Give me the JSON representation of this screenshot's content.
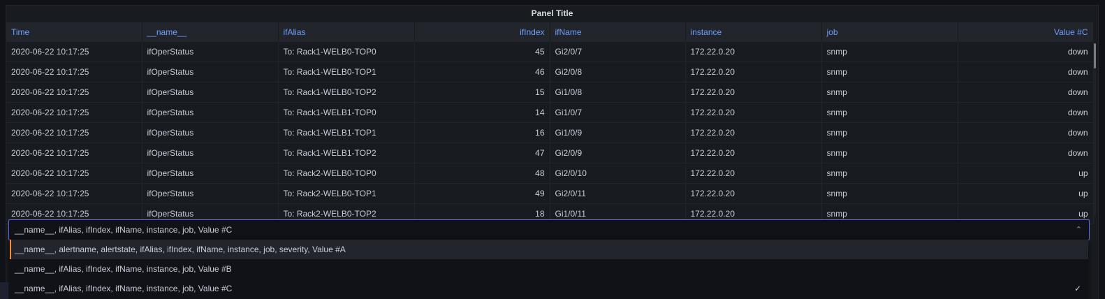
{
  "panel": {
    "title": "Panel Title"
  },
  "table": {
    "columns": [
      "Time",
      "__name__",
      "ifAlias",
      "ifIndex",
      "ifName",
      "instance",
      "job",
      "Value #C"
    ],
    "rows": [
      [
        "2020-06-22 10:17:25",
        "ifOperStatus",
        "To: Rack1-WELB0-TOP0",
        "45",
        "Gi2/0/7",
        "172.22.0.20",
        "snmp",
        "down"
      ],
      [
        "2020-06-22 10:17:25",
        "ifOperStatus",
        "To: Rack1-WELB0-TOP1",
        "46",
        "Gi2/0/8",
        "172.22.0.20",
        "snmp",
        "down"
      ],
      [
        "2020-06-22 10:17:25",
        "ifOperStatus",
        "To: Rack1-WELB0-TOP2",
        "15",
        "Gi1/0/8",
        "172.22.0.20",
        "snmp",
        "down"
      ],
      [
        "2020-06-22 10:17:25",
        "ifOperStatus",
        "To: Rack1-WELB1-TOP0",
        "14",
        "Gi1/0/7",
        "172.22.0.20",
        "snmp",
        "down"
      ],
      [
        "2020-06-22 10:17:25",
        "ifOperStatus",
        "To: Rack1-WELB1-TOP1",
        "16",
        "Gi1/0/9",
        "172.22.0.20",
        "snmp",
        "down"
      ],
      [
        "2020-06-22 10:17:25",
        "ifOperStatus",
        "To: Rack1-WELB1-TOP2",
        "47",
        "Gi2/0/9",
        "172.22.0.20",
        "snmp",
        "down"
      ],
      [
        "2020-06-22 10:17:25",
        "ifOperStatus",
        "To: Rack2-WELB0-TOP0",
        "48",
        "Gi2/0/10",
        "172.22.0.20",
        "snmp",
        "up"
      ],
      [
        "2020-06-22 10:17:25",
        "ifOperStatus",
        "To: Rack2-WELB0-TOP1",
        "49",
        "Gi2/0/11",
        "172.22.0.20",
        "snmp",
        "up"
      ],
      [
        "2020-06-22 10:17:25",
        "ifOperStatus",
        "To: Rack2-WELB0-TOP2",
        "18",
        "Gi1/0/11",
        "172.22.0.20",
        "snmp",
        "up"
      ]
    ]
  },
  "frame_select": {
    "value": "__name__, ifAlias, ifIndex, ifName, instance, job, Value #C",
    "icon": "chevron-up-icon",
    "options": [
      {
        "label": "__name__, alertname, alertstate, ifAlias, ifIndex, ifName, instance, job, severity, Value #A",
        "active": true,
        "checked": false
      },
      {
        "label": "__name__, ifAlias, ifIndex, ifName, instance, job, Value #B",
        "active": false,
        "checked": false
      },
      {
        "label": "__name__, ifAlias, ifIndex, ifName, instance, job, Value #C",
        "active": false,
        "checked": true
      }
    ]
  },
  "colors": {
    "header_text": "#6e9fff",
    "focus_border": "#5b6ce0",
    "active_option_marker": "#ff8833"
  }
}
